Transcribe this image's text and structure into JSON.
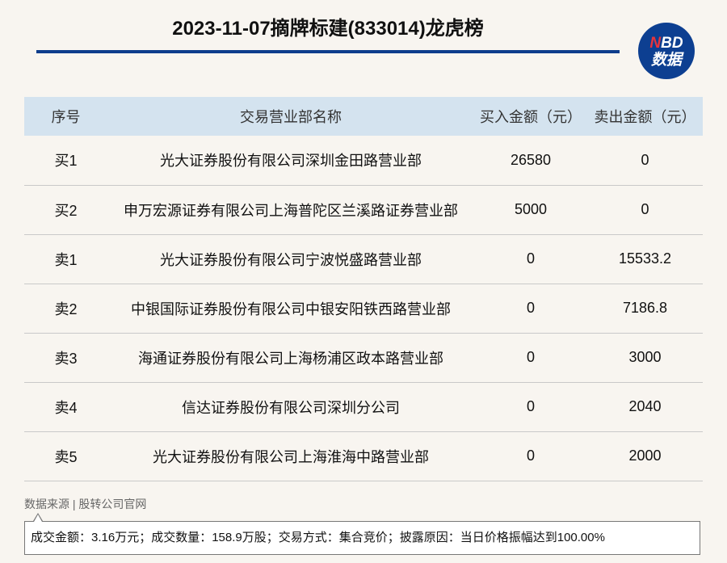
{
  "header": {
    "title": "2023-11-07摘牌标建(833014)龙虎榜",
    "logo_n": "N",
    "logo_bd": "BD",
    "logo_line2": "数据"
  },
  "table": {
    "columns": [
      "序号",
      "交易营业部名称",
      "买入金额（元）",
      "卖出金额（元）"
    ],
    "rows": [
      {
        "seq": "买1",
        "name": "光大证券股份有限公司深圳金田路营业部",
        "buy": "26580",
        "sell": "0"
      },
      {
        "seq": "买2",
        "name": "申万宏源证券有限公司上海普陀区兰溪路证券营业部",
        "buy": "5000",
        "sell": "0"
      },
      {
        "seq": "卖1",
        "name": "光大证券股份有限公司宁波悦盛路营业部",
        "buy": "0",
        "sell": "15533.2"
      },
      {
        "seq": "卖2",
        "name": "中银国际证券股份有限公司中银安阳铁西路营业部",
        "buy": "0",
        "sell": "7186.8"
      },
      {
        "seq": "卖3",
        "name": "海通证券股份有限公司上海杨浦区政本路营业部",
        "buy": "0",
        "sell": "3000"
      },
      {
        "seq": "卖4",
        "name": "信达证券股份有限公司深圳分公司",
        "buy": "0",
        "sell": "2040"
      },
      {
        "seq": "卖5",
        "name": "光大证券股份有限公司上海淮海中路营业部",
        "buy": "0",
        "sell": "2000"
      }
    ]
  },
  "footer": {
    "source": "数据来源 | 股转公司官网",
    "note": "成交金额：3.16万元；成交数量：158.9万股；交易方式：集合竞价；披露原因：当日价格振幅达到100.00%"
  },
  "colors": {
    "accent": "#0d3d8c",
    "header_bg": "#d4e3ef",
    "logo_red": "#e8343c"
  }
}
